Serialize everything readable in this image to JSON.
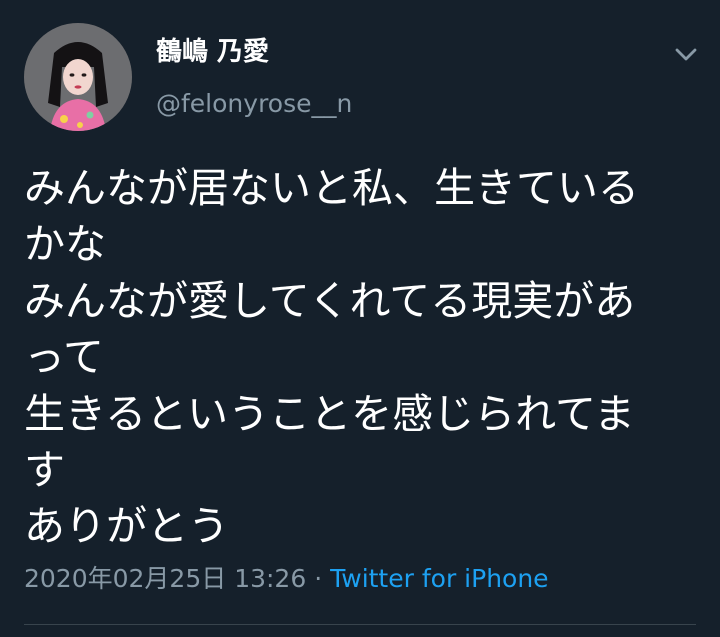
{
  "tweet": {
    "author": {
      "display_name": "鶴嶋 乃愛",
      "handle": "@felonyrose__n"
    },
    "text_lines": [
      "みんなが居ないと私、生きている",
      "かな",
      "みんなが愛してくれてる現実があ",
      "って",
      "生きるということを感じられてま",
      "す",
      "ありがとう"
    ],
    "timestamp": "2020年02月25日 13:26",
    "separator": "·",
    "source": "Twitter for iPhone"
  },
  "icons": {
    "menu": "chevron-down-icon"
  },
  "colors": {
    "background": "#15202b",
    "primary_text": "#ffffff",
    "secondary_text": "#8899a6",
    "link": "#1da1f2",
    "divider": "#38444d"
  }
}
